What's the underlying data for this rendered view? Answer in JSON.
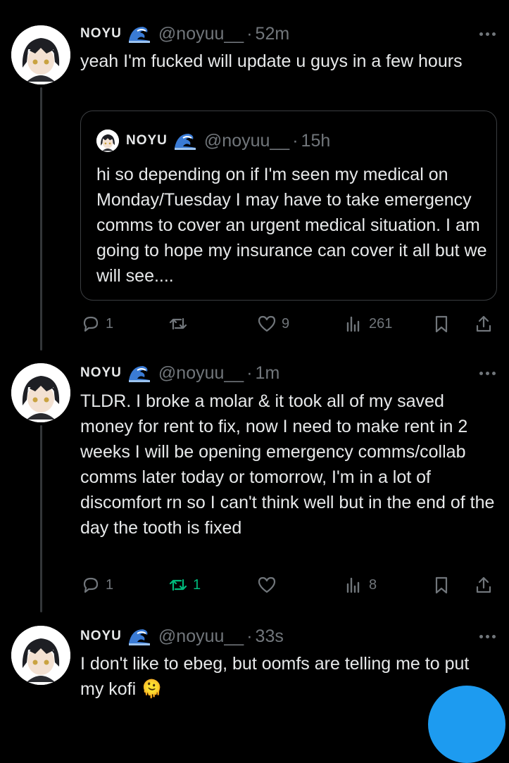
{
  "colors": {
    "background": "#000000",
    "text": "#e7e9ea",
    "muted": "#71767b",
    "retweet_active": "#00ba7c",
    "accent": "#1d9bf0"
  },
  "posts": [
    {
      "display_name": "NOYU",
      "badge_icon": "wave-icon",
      "handle": "@noyuu__",
      "separator": "·",
      "time": "52m",
      "text": "yeah I'm fucked will update u guys in a few hours",
      "quote": {
        "display_name": "NOYU",
        "handle": "@noyuu__",
        "separator": "·",
        "time": "15h",
        "text": "hi so depending on if I'm seen my medical on Monday/Tuesday I may have to take emergency comms to cover an urgent medical situation. I am going to hope my insurance can cover it all but we will see...."
      },
      "actions": {
        "replies": "1",
        "reposts": "",
        "likes": "9",
        "views": "261"
      }
    },
    {
      "display_name": "NOYU",
      "badge_icon": "wave-icon",
      "handle": "@noyuu__",
      "separator": "·",
      "time": "1m",
      "text": "TLDR. I broke a molar & it took all of my saved money for rent to fix, now I need to make rent in 2 weeks  I will be opening emergency comms/collab comms later today or tomorrow, I'm in a lot of discomfort rn so I can't think well but in the end of the day the tooth is fixed",
      "actions": {
        "replies": "1",
        "reposts": "1",
        "likes": "",
        "views": "8"
      }
    },
    {
      "display_name": "NOYU",
      "badge_icon": "wave-icon",
      "handle": "@noyuu__",
      "separator": "·",
      "time": "33s",
      "text": "I don't like to ebeg, but oomfs are telling me to put my kofi 🫠"
    }
  ]
}
